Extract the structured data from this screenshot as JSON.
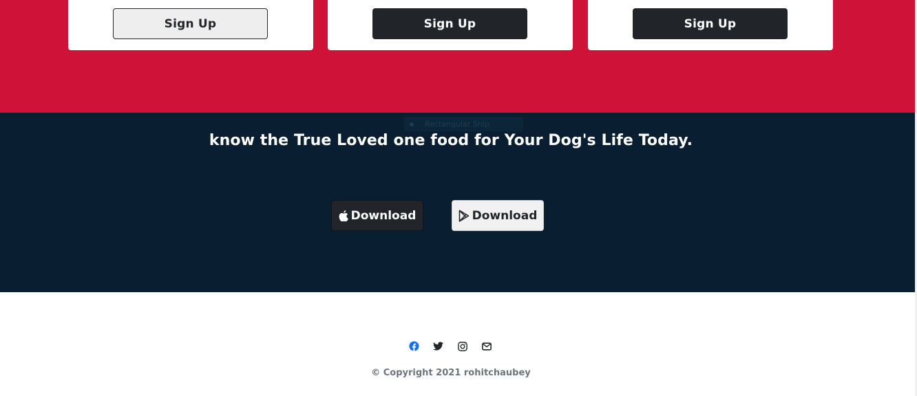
{
  "pricing": {
    "cards": [
      {
        "button_label": "Sign Up",
        "style": "light"
      },
      {
        "button_label": "Sign Up",
        "style": "dark"
      },
      {
        "button_label": "Sign Up",
        "style": "dark"
      }
    ]
  },
  "snip_overlay": {
    "label": "Rectangular Snip"
  },
  "cta": {
    "title": "know the True Loved one food for Your Dog's Life Today.",
    "apple_button": {
      "label": "Download",
      "icon": "apple-icon"
    },
    "play_button": {
      "label": "Download",
      "icon": "google-play-icon"
    }
  },
  "footer": {
    "social_icons": [
      "facebook-icon",
      "twitter-icon",
      "instagram-icon",
      "envelope-icon"
    ],
    "copyright": "© Copyright 2021 rohitchaubey"
  },
  "colors": {
    "pricing_bg": "#cf1238",
    "cta_bg": "#0a1e32",
    "dark_button": "#212529",
    "facebook_blue": "#0d6efd"
  }
}
